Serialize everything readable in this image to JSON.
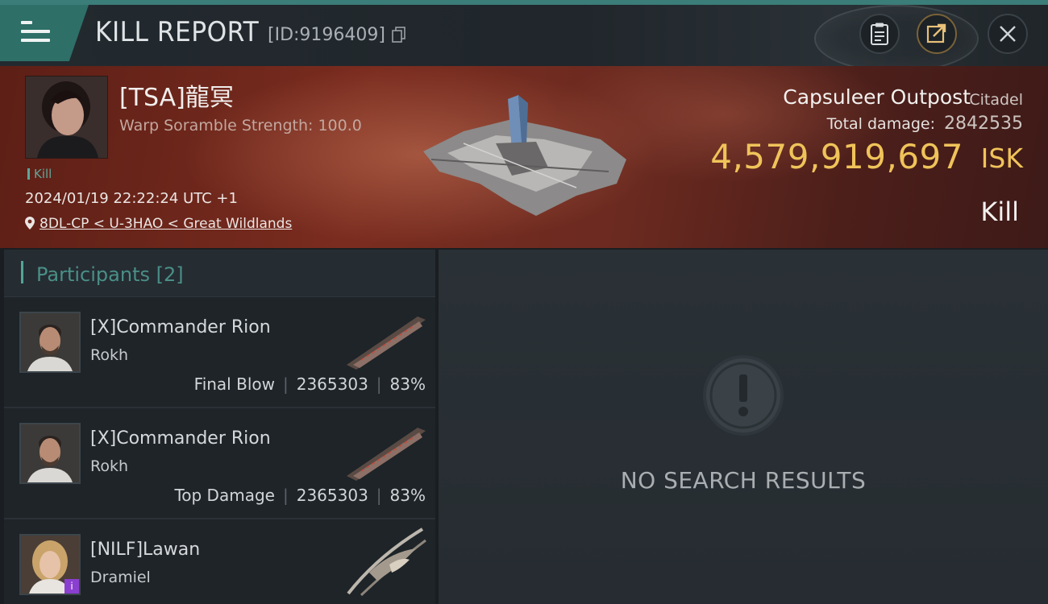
{
  "header": {
    "title": "KILL REPORT",
    "report_id": "[ID:9196409]",
    "icons": [
      "menu-icon",
      "copy-icon",
      "clipboard-icon",
      "share-icon",
      "close-icon"
    ]
  },
  "victim": {
    "name": "[TSA]龍冥",
    "subtitle": "Warp Soramble Strength: 100.0",
    "tag": "Kill",
    "datetime": "2024/01/19 22:22:24 UTC +1",
    "location": "8DL-CP < U-3HAO < Great Wildlands"
  },
  "target": {
    "name": "Capsuleer Outpost",
    "type": "Citadel",
    "damage_label": "Total damage:",
    "damage_value": "2842535",
    "isk_value": "4,579,919,697",
    "isk_unit": "ISK",
    "result": "Kill"
  },
  "participants": {
    "label": "Participants",
    "count": "[2]",
    "rows": [
      {
        "name": "[X]Commander Rion",
        "ship": "Rokh",
        "role": "Final Blow",
        "damage": "2365303",
        "percent": "83%"
      },
      {
        "name": "[X]Commander Rion",
        "ship": "Rokh",
        "role": "Top Damage",
        "damage": "2365303",
        "percent": "83%"
      },
      {
        "name": "[NILF]Lawan",
        "ship": "Dramiel",
        "role": "",
        "damage": "",
        "percent": ""
      }
    ]
  },
  "results": {
    "empty_text": "NO SEARCH RESULTS"
  },
  "colors": {
    "accent_teal": "#3b7d78",
    "isk_gold": "#f0c35a",
    "banner_red": "#6b2a20"
  }
}
